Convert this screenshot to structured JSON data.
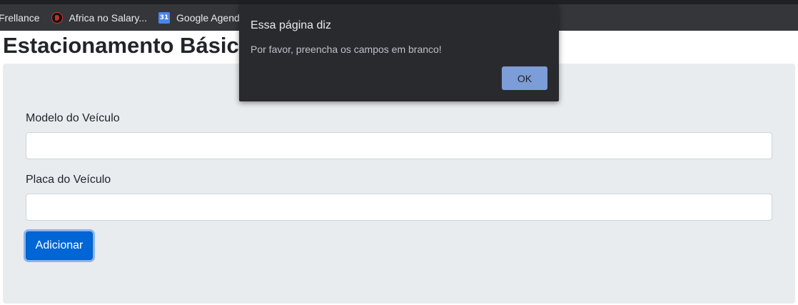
{
  "bookmarks": [
    {
      "label": "Frellance",
      "icon": null
    },
    {
      "label": "Africa no Salary...",
      "icon": "africa-favicon-icon"
    },
    {
      "label": "Google Agend",
      "icon": "google-calendar-icon",
      "icon_text": "31"
    }
  ],
  "page": {
    "title": "Estacionamento Básico",
    "form": {
      "model_label": "Modelo do Veículo",
      "model_value": "",
      "plate_label": "Placa do Veículo",
      "plate_value": "",
      "submit_label": "Adicionar"
    }
  },
  "dialog": {
    "title": "Essa página diz",
    "message": "Por favor, preencha os campos em branco!",
    "ok_label": "OK"
  },
  "colors": {
    "bookmarks_bar": "#35363a",
    "jumbotron": "#e9ecef",
    "primary_button": "#0066d6",
    "dialog_bg": "#292a2d",
    "dialog_ok": "#7d9dd8"
  }
}
